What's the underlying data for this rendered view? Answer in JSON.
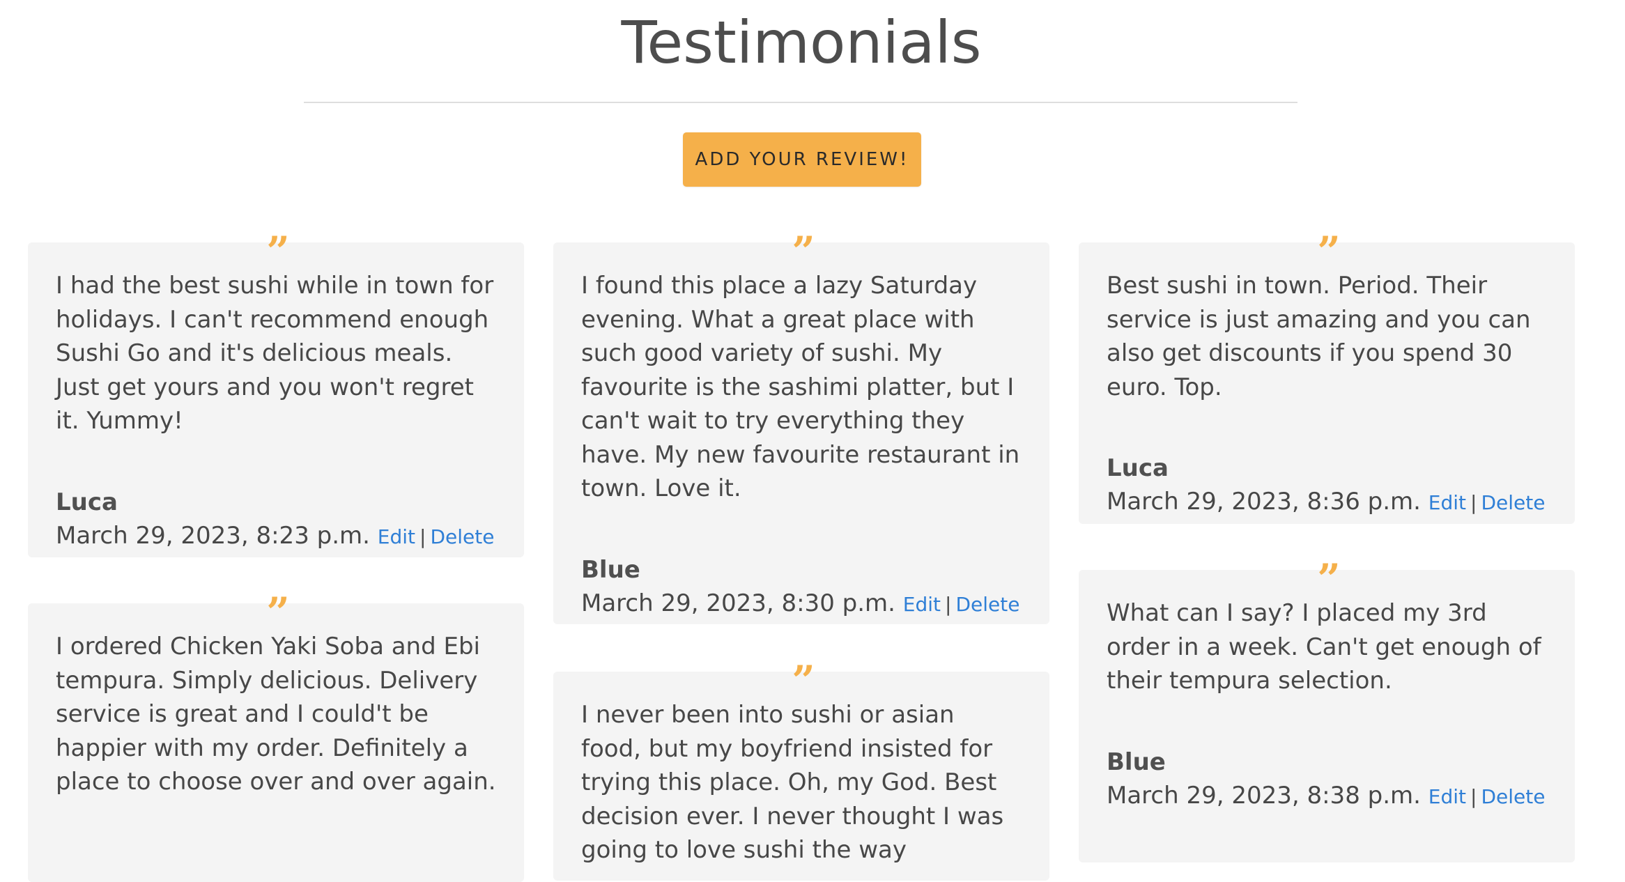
{
  "page": {
    "title": "Testimonials",
    "add_review_label": "ADD YOUR REVIEW!"
  },
  "colors": {
    "accent": "#f5b04a",
    "card_background": "#f4f4f4",
    "link": "#2f7fd6"
  },
  "quote_icon": "double-quote-icon",
  "actions": {
    "edit_label": "Edit",
    "separator": "|",
    "delete_label": "Delete"
  },
  "reviews": [
    {
      "text": "I had the best sushi while in town for holidays. I can't recommend enough Sushi Go and it's delicious meals. Just get yours and you won't regret it. Yummy!",
      "author": "Luca",
      "date": "March 29, 2023, 8:23 p.m."
    },
    {
      "text": "I found this place a lazy Saturday evening. What a great place with such good variety of sushi. My favourite is the sashimi platter, but I can't wait to try everything they have. My new favourite restaurant in town. Love it.",
      "author": "Blue",
      "date": "March 29, 2023, 8:30 p.m."
    },
    {
      "text": "Best sushi in town. Period. Their service is just amazing and you can also get discounts if you spend 30 euro. Top.",
      "author": "Luca",
      "date": "March 29, 2023, 8:36 p.m."
    },
    {
      "text": "I ordered Chicken Yaki Soba and Ebi tempura. Simply delicious. Delivery service is great and I could't be happier with my order. Definitely a place to choose over and over again.",
      "author": "",
      "date": ""
    },
    {
      "text": "I never been into sushi or asian food, but my boyfriend insisted for trying this place. Oh, my God. Best decision ever. I never thought I was going to love sushi the way",
      "author": "",
      "date": ""
    },
    {
      "text": "What can I say? I placed my 3rd order in a week. Can't get enough of their tempura selection.",
      "author": "Blue",
      "date": "March 29, 2023, 8:38 p.m."
    }
  ]
}
